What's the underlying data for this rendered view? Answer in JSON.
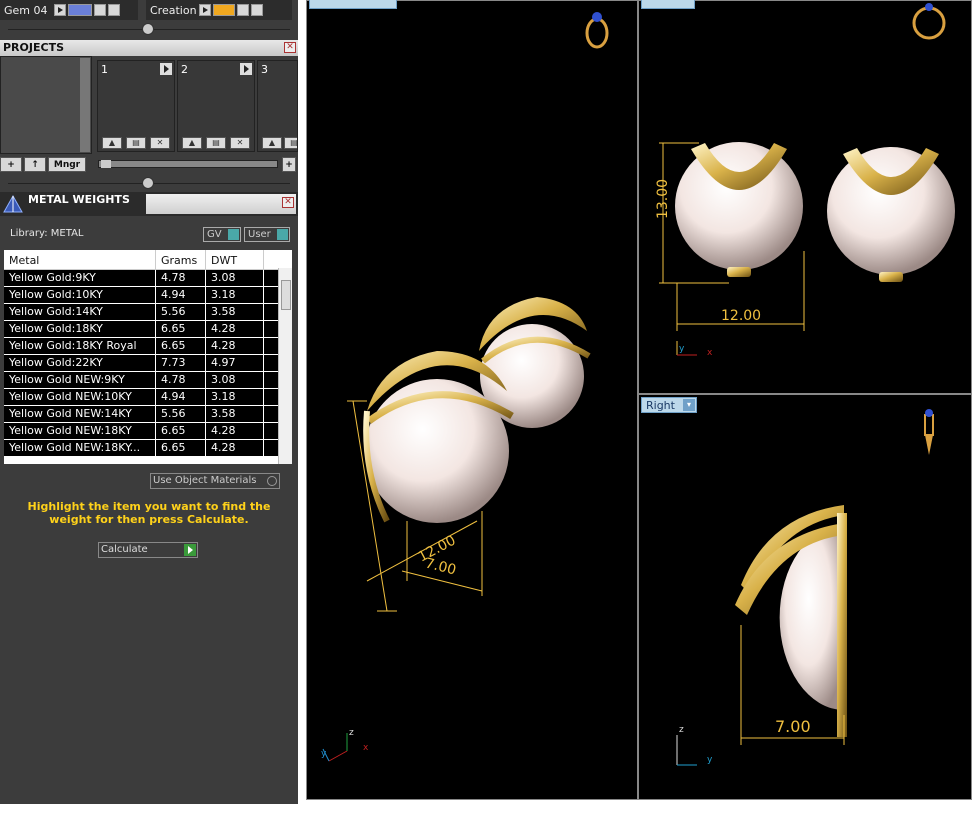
{
  "top_bar": {
    "layer1_label": "Gem 04",
    "layer2_label": "Creation"
  },
  "projects": {
    "title": "PROJECTS",
    "slots": [
      "1",
      "2",
      "3"
    ],
    "manager_label": "Mngr"
  },
  "metal_weights": {
    "title": "METAL WEIGHTS",
    "library_label": "Library: METAL",
    "gv_label": "GV",
    "user_label": "User",
    "columns": [
      "Metal",
      "Grams",
      "DWT"
    ],
    "rows": [
      {
        "metal": "Yellow Gold:9KY",
        "grams": "4.78",
        "dwt": "3.08"
      },
      {
        "metal": "Yellow Gold:10KY",
        "grams": "4.94",
        "dwt": "3.18"
      },
      {
        "metal": "Yellow Gold:14KY",
        "grams": "5.56",
        "dwt": "3.58"
      },
      {
        "metal": "Yellow Gold:18KY",
        "grams": "6.65",
        "dwt": "4.28"
      },
      {
        "metal": "Yellow Gold:18KY Royal",
        "grams": "6.65",
        "dwt": "4.28"
      },
      {
        "metal": "Yellow Gold:22KY",
        "grams": "7.73",
        "dwt": "4.97"
      },
      {
        "metal": "Yellow Gold NEW:9KY",
        "grams": "4.78",
        "dwt": "3.08"
      },
      {
        "metal": "Yellow Gold NEW:10KY",
        "grams": "4.94",
        "dwt": "3.18"
      },
      {
        "metal": "Yellow Gold NEW:14KY",
        "grams": "5.56",
        "dwt": "3.58"
      },
      {
        "metal": "Yellow Gold NEW:18KY",
        "grams": "6.65",
        "dwt": "4.28"
      },
      {
        "metal": "Yellow Gold NEW:18KY...",
        "grams": "6.65",
        "dwt": "4.28"
      }
    ],
    "use_object_materials_label": "Use Object Materials",
    "hint": "Highlight the item you want to find the weight for then press Calculate.",
    "calculate_label": "Calculate"
  },
  "viewports": {
    "right_view_label": "Right",
    "front_dims": {
      "height": "13.00",
      "width": "12.00"
    },
    "right_dims": {
      "depth": "7.00"
    },
    "perspective_dims": {
      "a": "12.00",
      "b": "7.00"
    },
    "axis_x": "x",
    "axis_y": "y",
    "axis_z": "z"
  },
  "colors": {
    "gold": "#d9b24a",
    "pearl": "#f3e6e2",
    "dimension": "#f0c040",
    "hint_text": "#ffd21a"
  }
}
